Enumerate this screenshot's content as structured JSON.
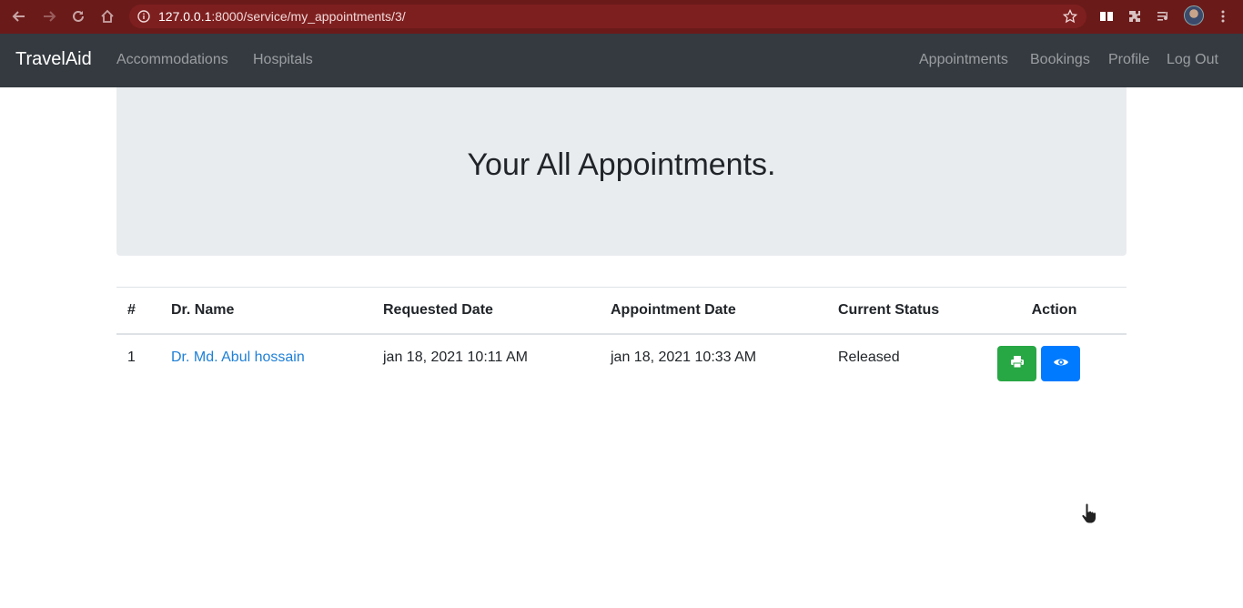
{
  "browser": {
    "url_host": "127.0.0.1",
    "url_rest": ":8000/service/my_appointments/3/"
  },
  "navbar": {
    "brand": "TravelAid",
    "left_links": [
      "Accommodations",
      "Hospitals"
    ],
    "right_links": [
      "Appointments",
      "Bookings",
      "Profile",
      "Log Out"
    ]
  },
  "jumbotron": {
    "title": "Your All Appointments."
  },
  "table": {
    "headers": [
      "#",
      "Dr. Name",
      "Requested Date",
      "Appointment Date",
      "Current Status",
      "Action"
    ],
    "rows": [
      {
        "num": "1",
        "doctor": "Dr. Md. Abul hossain",
        "requested": "jan 18, 2021 10:11 AM",
        "appointment": "jan 18, 2021 10:33 AM",
        "status": "Released",
        "actions": [
          "print-icon",
          "eye-icon"
        ]
      }
    ]
  },
  "colors": {
    "chrome_bg": "#6b1a1a",
    "navbar_bg": "#343a40",
    "jumbotron_bg": "#e9ecef",
    "link": "#1e7fd6",
    "print_button": "#28a745",
    "view_button": "#007bff"
  }
}
